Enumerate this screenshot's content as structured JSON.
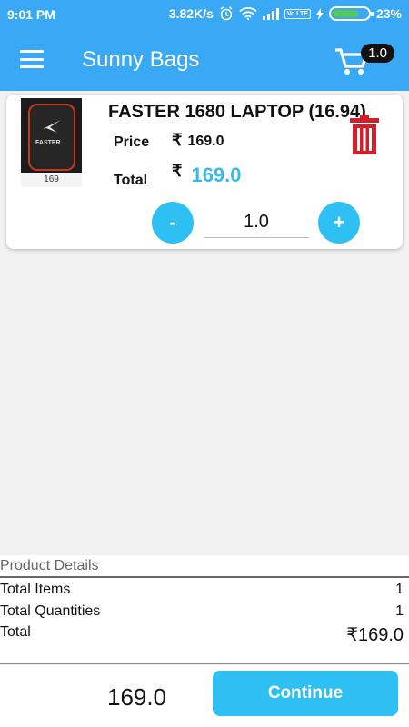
{
  "status_bar": {
    "time": "9:01 PM",
    "network_speed": "3.82K/s",
    "volte": "Vo LTE",
    "battery_percent": "23%",
    "battery_level": 0.23
  },
  "app_bar": {
    "title": "Sunny Bags",
    "cart_count": "1.0"
  },
  "cart_item": {
    "title": "FASTER 1680 LAPTOP (16.94)",
    "image_label": "169",
    "image_brand": "FASTER",
    "price_label": "Price",
    "currency_symbol": "₹",
    "price": "169.0",
    "total_label": "Total",
    "total": "169.0",
    "quantity": "1.0",
    "minus_label": "-",
    "plus_label": "+"
  },
  "details": {
    "header": "Product Details",
    "rows": [
      {
        "label": "Total Items",
        "value": "1"
      },
      {
        "label": "Total Quantities",
        "value": "1"
      },
      {
        "label": "Total",
        "value": "₹169.0"
      }
    ]
  },
  "bottom_bar": {
    "total": "169.0",
    "continue_label": "Continue"
  },
  "colors": {
    "primary": "#3aa9f5",
    "accent": "#2fc0f3",
    "delete": "#d11f2b"
  }
}
